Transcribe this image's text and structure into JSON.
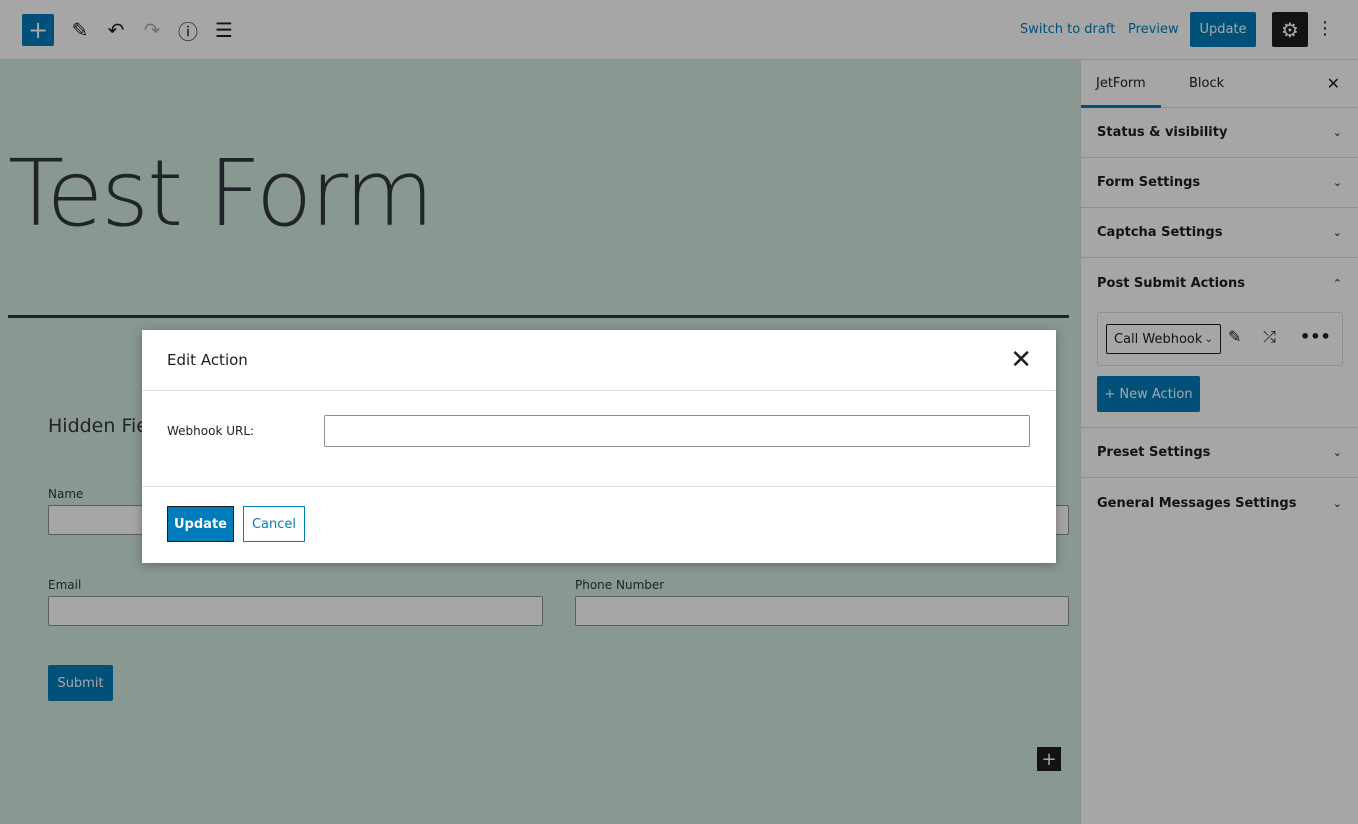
{
  "toolbar": {
    "add": "+",
    "switch_draft": "Switch to draft",
    "preview": "Preview",
    "update": "Update",
    "icons": [
      "plus-icon",
      "pencil-icon",
      "undo-icon",
      "redo-icon",
      "info-icon",
      "list-view-icon",
      "gear-icon",
      "kebab-icon"
    ]
  },
  "editor": {
    "title": "Test Form",
    "hidden_heading": "Hidden Field",
    "name_label": "Name",
    "email_label": "Email",
    "phone_label": "Phone Number",
    "submit": "Submit",
    "add_block": "+"
  },
  "sidebar": {
    "tabs": [
      "JetForm",
      "Block"
    ],
    "panels": [
      "Status & visibility",
      "Form Settings",
      "Captcha Settings",
      "Post Submit Actions",
      "Preset Settings",
      "General Messages Settings"
    ],
    "action_select": "Call Webhook",
    "new_action": "+ New Action"
  },
  "modal": {
    "title": "Edit Action",
    "webhook_label": "Webhook URL:",
    "webhook_value": "",
    "update": "Update",
    "cancel": "Cancel"
  },
  "colors": {
    "accent": "#007cba",
    "overlay": "rgba(0,0,0,0.35)"
  }
}
